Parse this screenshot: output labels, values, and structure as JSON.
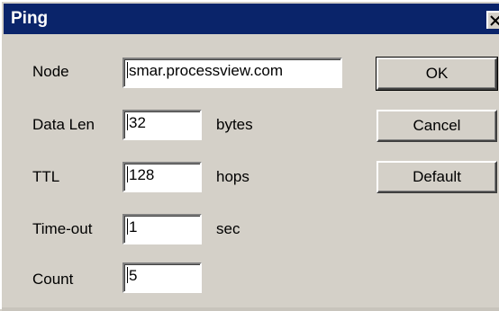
{
  "window": {
    "title": "Ping",
    "close_glyph": "close-icon"
  },
  "form": {
    "node": {
      "label": "Node",
      "value": "smar.processview.com"
    },
    "data_len": {
      "label": "Data Len",
      "value": "32",
      "unit": "bytes"
    },
    "ttl": {
      "label": "TTL",
      "value": "128",
      "unit": "hops"
    },
    "timeout": {
      "label": "Time-out",
      "value": "1",
      "unit": "sec"
    },
    "count": {
      "label": "Count",
      "value": "5"
    }
  },
  "buttons": {
    "ok": "OK",
    "cancel": "Cancel",
    "default": "Default"
  },
  "colors": {
    "title_bar": "#0a246a",
    "dialog_bg": "#d4d0c8"
  }
}
